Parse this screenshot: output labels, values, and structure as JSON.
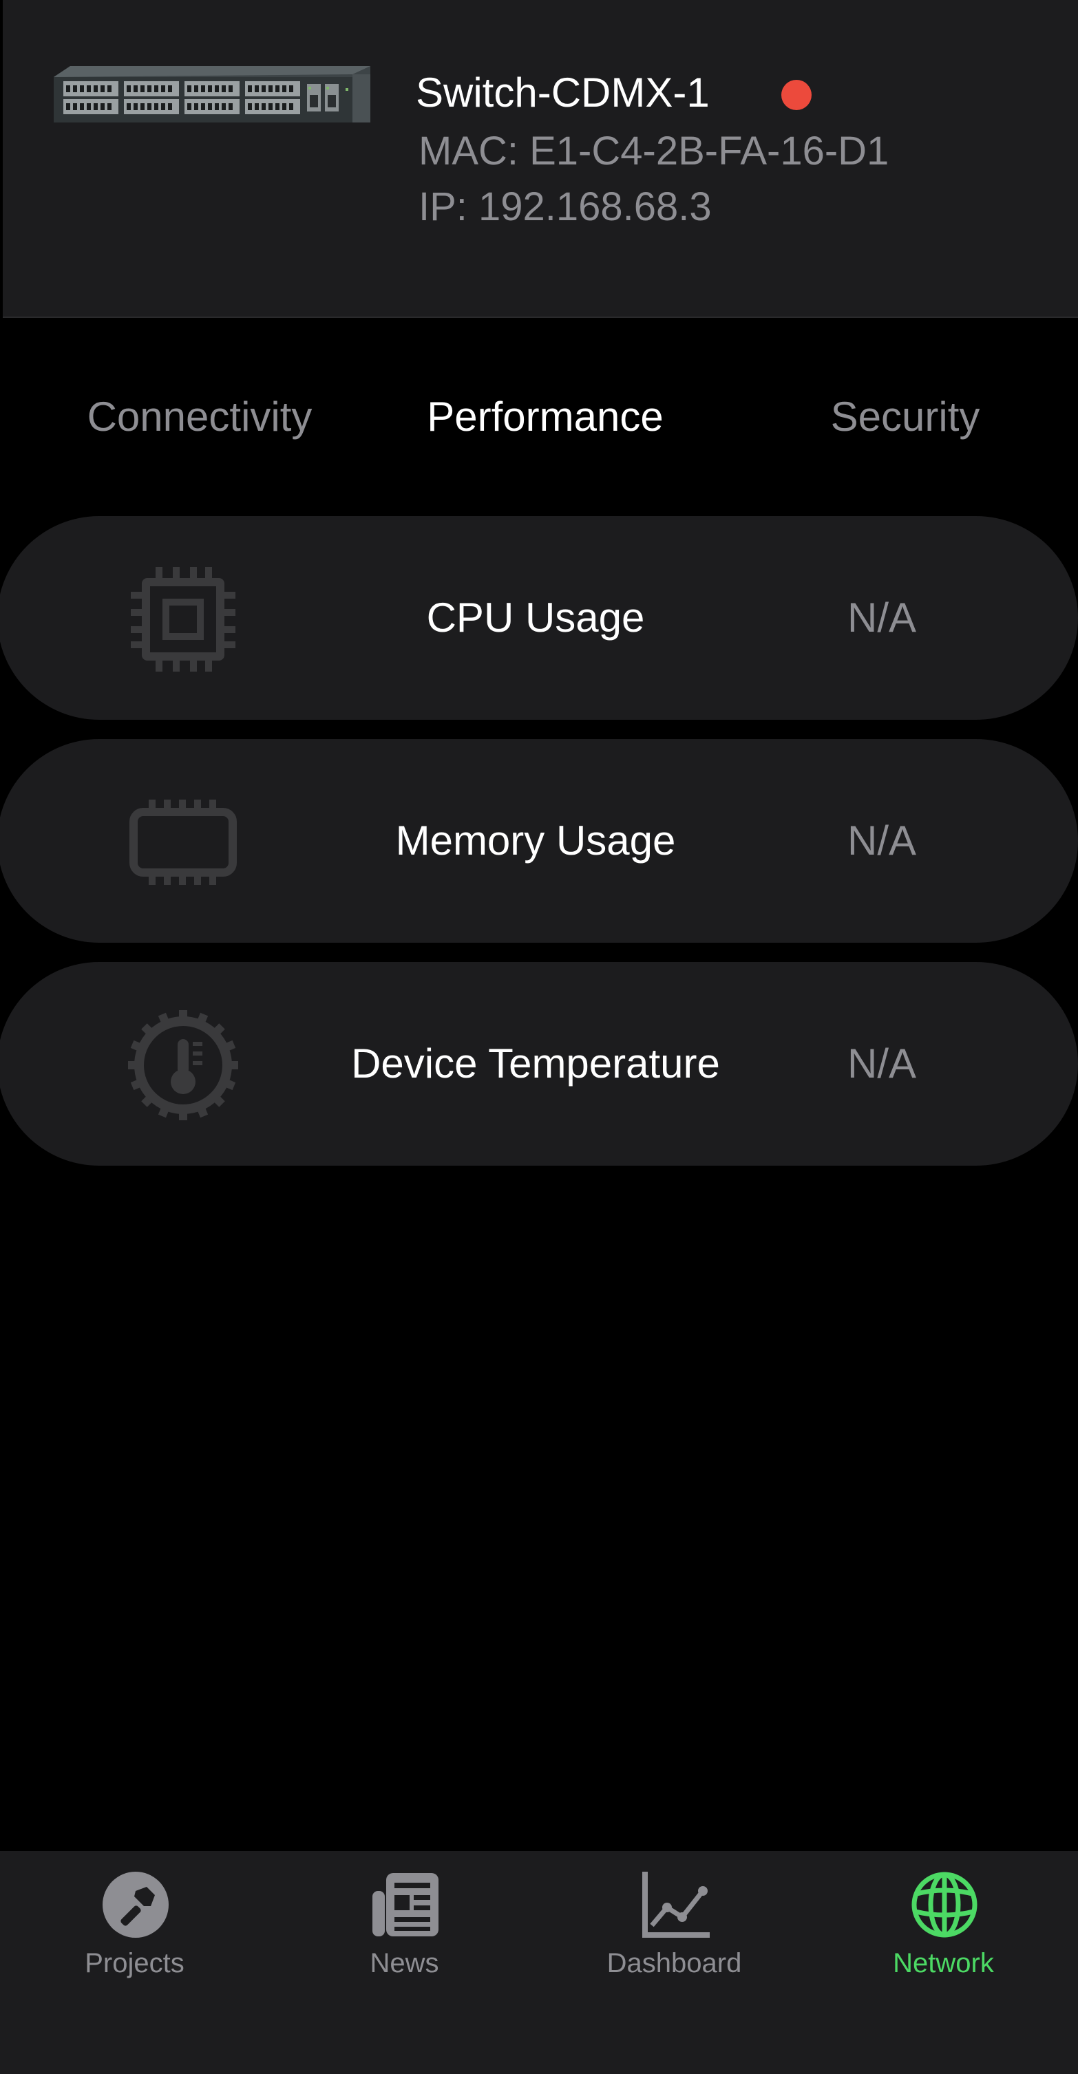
{
  "device": {
    "name": "Switch-CDMX-1",
    "mac": "MAC: E1-C4-2B-FA-16-D1",
    "ip": "IP: 192.168.68.3",
    "status_color": "#ec4a3c"
  },
  "tabs": [
    {
      "label": "Connectivity",
      "active": false
    },
    {
      "label": "Performance",
      "active": true
    },
    {
      "label": "Security",
      "active": false
    }
  ],
  "metrics": [
    {
      "label": "CPU Usage",
      "value": "N/A",
      "icon": "cpu-icon"
    },
    {
      "label": "Memory Usage",
      "value": "N/A",
      "icon": "memory-icon"
    },
    {
      "label": "Device Temperature",
      "value": "N/A",
      "icon": "temperature-icon"
    }
  ],
  "tab_bar": [
    {
      "label": "Projects",
      "icon": "hammer-icon",
      "active": false
    },
    {
      "label": "News",
      "icon": "newspaper-icon",
      "active": false
    },
    {
      "label": "Dashboard",
      "icon": "chart-icon",
      "active": false
    },
    {
      "label": "Network",
      "icon": "globe-icon",
      "active": true
    }
  ],
  "colors": {
    "accent": "#4cd964",
    "background": "#000000",
    "card": "#1c1c1e",
    "muted_text": "#8e8e93"
  }
}
